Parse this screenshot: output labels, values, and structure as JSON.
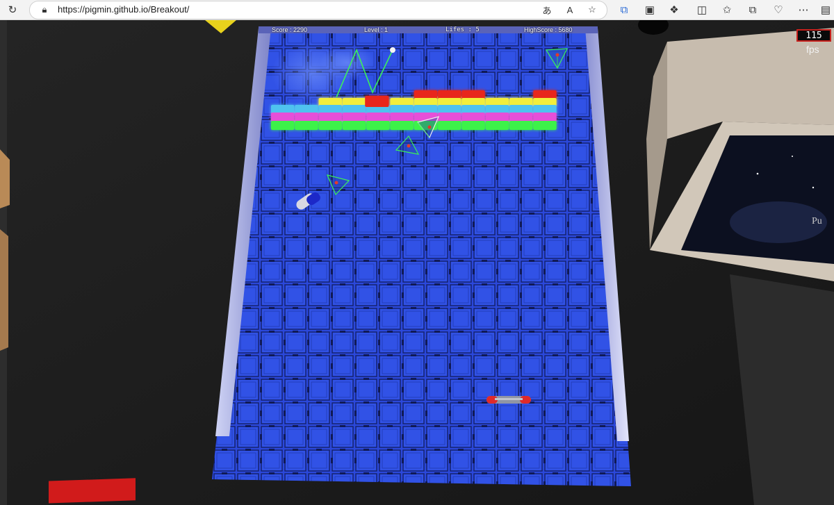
{
  "browser": {
    "url_host": "https://pigmin.github.io/",
    "url_path": "Breakout/",
    "icons": [
      "reload-icon",
      "lock-icon",
      "translate-icon",
      "read-aloud-icon",
      "favorite-star-icon",
      "screen-cast-icon",
      "app-icon",
      "extensions-icon",
      "split-screen-icon",
      "favorites-icon",
      "collections-icon",
      "performance-icon",
      "more-icon",
      "sidebar-icon"
    ]
  },
  "hud": {
    "score": "Score : 2290",
    "level": "Level : 1",
    "lives": "Lifes : 5",
    "highscore": "HighScore : 5680"
  },
  "fps": {
    "value": "115",
    "label": "fps"
  },
  "colors": {
    "board": "#2a45d8",
    "brick_red": "#e8281e",
    "brick_yellow": "#f2ee3a",
    "brick_magenta": "#e64fd8",
    "brick_cyan": "#4fc2ef",
    "brick_green": "#3cf24a",
    "fps_border": "#c8201c"
  },
  "bricks": {
    "rows": [
      {
        "color": "red",
        "columns": [
          6,
          7,
          8,
          11
        ]
      },
      {
        "color": "yellow",
        "columns": [
          2,
          3,
          5,
          6,
          7,
          8,
          9,
          10,
          11
        ]
      },
      {
        "color": "cyan",
        "columns": [
          0,
          1,
          2,
          3,
          4,
          5,
          6,
          7,
          8,
          9,
          10,
          11
        ]
      },
      {
        "color": "magenta",
        "columns": [
          0,
          1,
          2,
          3,
          4,
          5,
          6,
          7,
          8,
          9,
          10,
          11
        ]
      },
      {
        "color": "green",
        "columns": [
          0,
          1,
          2,
          3,
          4,
          5,
          6,
          7,
          8,
          9,
          10,
          11
        ]
      }
    ],
    "loose_red_brick_column": 4
  },
  "scene_objects": [
    "ball",
    "paddle",
    "powerup-capsule",
    "pyramid-enemy",
    "pyramid-enemy",
    "pyramid-enemy",
    "pyramid-enemy",
    "ball-trail",
    "particle-cloud",
    "room-wall-panel",
    "room-furniture-box"
  ]
}
